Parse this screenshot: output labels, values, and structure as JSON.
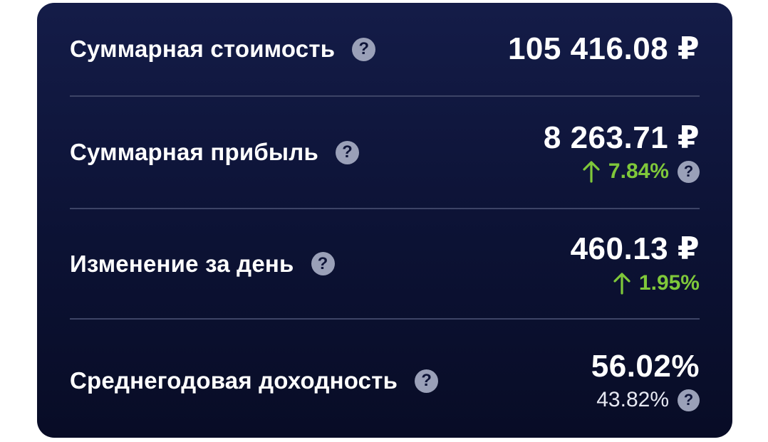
{
  "summary": {
    "rows": [
      {
        "label": "Суммарная стоимость",
        "value": "105 416.08 ₽"
      },
      {
        "label": "Суммарная прибыль",
        "value": "8 263.71 ₽",
        "change": "7.84%",
        "change_direction": "up"
      },
      {
        "label": "Изменение за день",
        "value": "460.13 ₽",
        "change": "1.95%",
        "change_direction": "up"
      },
      {
        "label": "Среднегодовая доходность",
        "value": "56.02%",
        "secondary": "43.82%"
      }
    ]
  },
  "icons": {
    "help": "question-circle-icon",
    "arrow": "arrow-up-icon"
  },
  "colors": {
    "card_background": "#0c1234",
    "positive": "#7fc83a",
    "divider": "#3d4466",
    "help_icon": "#9aa0b8"
  }
}
